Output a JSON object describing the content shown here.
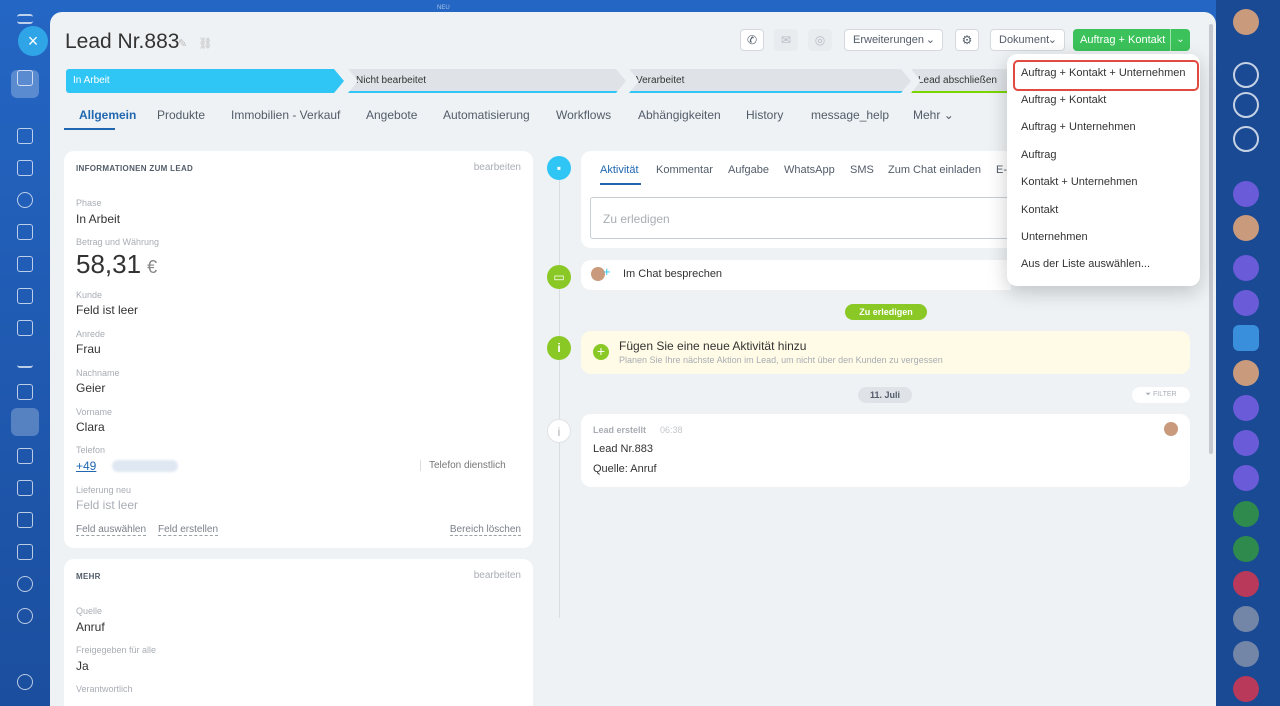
{
  "header": {
    "title": "Lead Nr.883",
    "edit_icons": "✎ ⛓",
    "extensions": "Erweiterungen",
    "document": "Dokument",
    "primary_action": "Auftrag + Kontakt",
    "top_small_label": "NEU"
  },
  "stages": [
    "In Arbeit",
    "Nicht bearbeitet",
    "Verarbeitet",
    "Lead abschließen"
  ],
  "tabs": [
    "Allgemein",
    "Produkte",
    "Immobilien - Verkauf",
    "Angebote",
    "Automatisierung",
    "Workflows",
    "Abhängigkeiten",
    "History",
    "message_help",
    "Mehr"
  ],
  "info_card": {
    "title": "INFORMATIONEN ZUM LEAD",
    "edit": "bearbeiten",
    "phase_label": "Phase",
    "phase_value": "In Arbeit",
    "amount_label": "Betrag und Währung",
    "amount_value": "58,31",
    "currency": "€",
    "kunde_label": "Kunde",
    "kunde_value": "Feld ist leer",
    "anrede_label": "Anrede",
    "anrede_value": "Frau",
    "nachname_label": "Nachname",
    "nachname_value": "Geier",
    "vorname_label": "Vorname",
    "vorname_value": "Clara",
    "telefon_label": "Telefon",
    "telefon_value": "+49",
    "telefon_type": "Telefon dienstlich",
    "lieferung_label": "Lieferung neu",
    "lieferung_value": "Feld ist leer",
    "select_field": "Feld auswählen",
    "create_field": "Feld erstellen",
    "delete_section": "Bereich löschen"
  },
  "more_card": {
    "title": "MEHR",
    "edit": "bearbeiten",
    "quelle_label": "Quelle",
    "quelle_value": "Anruf",
    "shared_label": "Freigegeben für alle",
    "shared_value": "Ja",
    "responsible_label": "Verantwortlich"
  },
  "activity": {
    "tabs": [
      "Aktivität",
      "Kommentar",
      "Aufgabe",
      "WhatsApp",
      "SMS",
      "Zum Chat einladen",
      "E-"
    ],
    "todo_placeholder": "Zu erledigen",
    "chat_label": "Im Chat besprechen",
    "todo_badge": "Zu erledigen",
    "add_title": "Fügen Sie eine neue Aktivität hinzu",
    "add_sub": "Planen Sie Ihre nächste Aktion im Lead, um nicht über den Kunden zu vergessen",
    "date_badge": "11. Juli",
    "filter": "FILTER",
    "created_title": "Lead erstellt",
    "created_time": "06:38",
    "created_name": "Lead Nr.883",
    "created_source": "Quelle: Anruf"
  },
  "dropdown": {
    "items": [
      "Auftrag + Kontakt + Unternehmen",
      "Auftrag + Kontakt",
      "Auftrag + Unternehmen",
      "Auftrag",
      "Kontakt + Unternehmen",
      "Kontakt",
      "Unternehmen",
      "Aus der Liste auswählen..."
    ]
  },
  "colors": {
    "accent": "#2067b0",
    "stage_active": "#2fc6f6",
    "primary_button": "#3bc25a",
    "highlight": "#e04a3f",
    "timeline_green": "#8ac826"
  }
}
